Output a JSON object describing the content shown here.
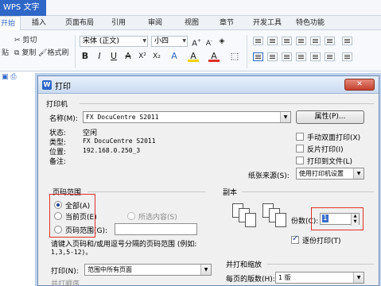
{
  "app": {
    "title": "WPS 文字"
  },
  "menu": {
    "start": "开始",
    "insert": "插入",
    "layout": "页面布局",
    "reference": "引用",
    "review": "审阅",
    "view": "视图",
    "chapter": "章节",
    "devtools": "开发工具",
    "special": "特色功能"
  },
  "ribbon": {
    "cut": "剪切",
    "copy": "复制",
    "format_painter": "格式刷",
    "paste_fragment": "贴",
    "font_name": "宋体 (正文)",
    "font_size": "小四",
    "bold": "B",
    "italic": "I",
    "underline": "U",
    "strike": "A",
    "superscript": "X²",
    "subscript": "X₂",
    "font_color": "A",
    "highlight": "A",
    "clear": "A"
  },
  "dialog": {
    "title": "打印",
    "close_label": "✕",
    "printer_group": "打印机",
    "name_label": "名称(M):",
    "printer_name": "FX DocuCentre S2011",
    "properties_button": "属性(P)...",
    "status_label": "状态:",
    "status_value": "空闲",
    "type_label": "类型:",
    "type_value": "FX DocuCentre S2011",
    "location_label": "位置:",
    "location_value": "192.168.0.250_3",
    "comment_label": "备注:",
    "manual_duplex": "手动双面打印(X)",
    "reverse_print": "反片打印(I)",
    "print_to_file": "打印到文件(L)",
    "paper_source_label": "纸张来源(S):",
    "paper_source_value": "使用打印机设置",
    "range_group": "页码范围",
    "range_all": "全部(A)",
    "range_current": "当前页(E)",
    "range_selection": "所选内容(S)",
    "range_pages": "页码范围(G):",
    "range_hint_1": "请键入页码和/或用逗号分隔的页码范围 (例如:",
    "range_hint_2": "1,3,5-12)。",
    "print_label": "打印(N):",
    "print_value": "范围中所有页面",
    "print_order": "并打顺序",
    "copies_group": "副本",
    "copies_label": "份数(C):",
    "copies_value": "1",
    "collate": "逐份打印(T)",
    "zoom_group": "并打和缩放",
    "pages_per_sheet_label": "每页的版数(H):",
    "pages_per_sheet_value": "1 版"
  },
  "colors": {
    "accent": "#2f67c7",
    "highlight": "#e0302a"
  }
}
